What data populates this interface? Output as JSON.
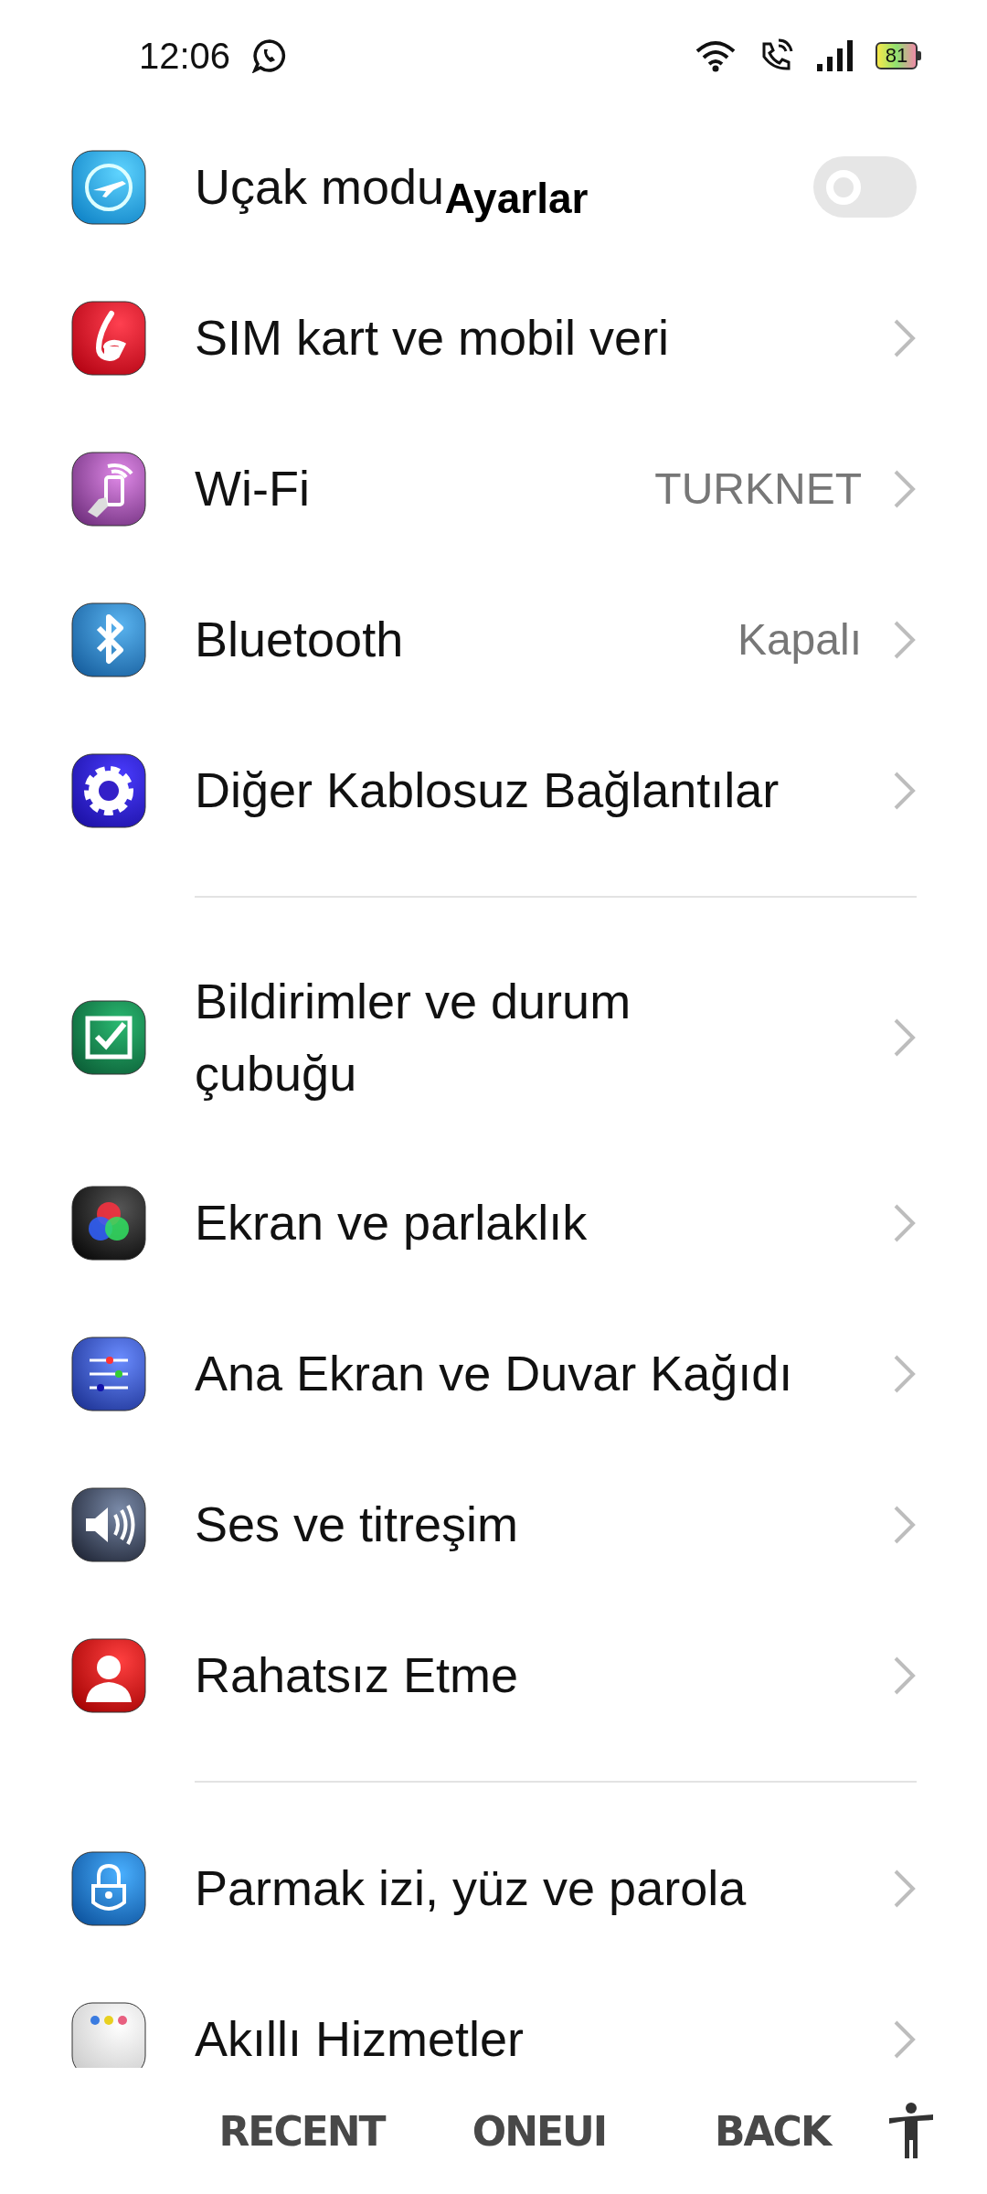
{
  "status_bar": {
    "time": "12:06",
    "battery": "81"
  },
  "title": "Ayarlar",
  "groups": [
    {
      "rows": [
        {
          "kind": "toggle",
          "label": "Uçak modu",
          "on": false
        },
        {
          "kind": "link",
          "label": "SIM kart ve mobil veri"
        },
        {
          "kind": "link",
          "label": "Wi-Fi",
          "value": "TURKNET"
        },
        {
          "kind": "link",
          "label": "Bluetooth",
          "value": "Kapalı"
        },
        {
          "kind": "link",
          "label": "Diğer Kablosuz Bağlantılar"
        }
      ]
    },
    {
      "rows": [
        {
          "kind": "link",
          "label": "Bildirimler ve durum\nçubuğu"
        },
        {
          "kind": "link",
          "label": "Ekran ve parlaklık"
        },
        {
          "kind": "link",
          "label": "Ana Ekran ve Duvar Kağıdı"
        },
        {
          "kind": "link",
          "label": "Ses ve titreşim"
        },
        {
          "kind": "link",
          "label": "Rahatsız Etme"
        }
      ]
    },
    {
      "rows": [
        {
          "kind": "link",
          "label": "Parmak izi, yüz ve parola"
        },
        {
          "kind": "link",
          "label": "Akıllı Hizmetler"
        }
      ]
    }
  ],
  "nav_bar": [
    "RECENT",
    "ONEUI",
    "BACK"
  ]
}
